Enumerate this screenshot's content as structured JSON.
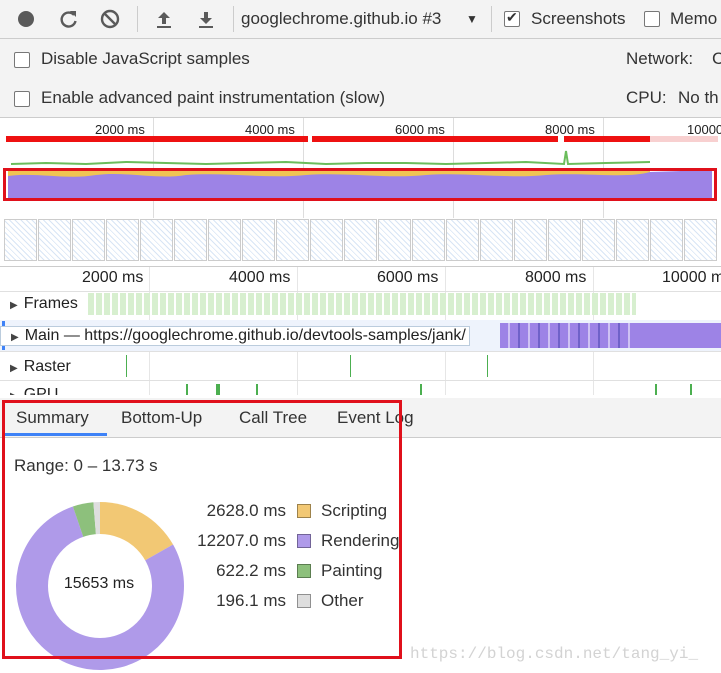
{
  "toolbar": {
    "icons": [
      "record-icon",
      "reload-icon",
      "clear-icon",
      "upload-icon",
      "download-icon"
    ],
    "profile_select": "googlechrome.github.io #3",
    "screenshots_label": "Screenshots",
    "screenshots_checked": true,
    "memory_label": "Memo",
    "memory_checked": false
  },
  "settings": {
    "disable_js_label": "Disable JavaScript samples",
    "paint_label": "Enable advanced paint instrumentation (slow)",
    "network_label": "Network:",
    "network_value": "C",
    "cpu_label": "CPU:",
    "cpu_value": "No th"
  },
  "overview": {
    "ticks": [
      "2000 ms",
      "4000 ms",
      "6000 ms",
      "8000 ms",
      "10000"
    ]
  },
  "timeline": {
    "ticks": [
      "2000 ms",
      "4000 ms",
      "6000 ms",
      "8000 ms",
      "10000 m"
    ],
    "tracks": {
      "frames": "Frames",
      "main": "Main — https://googlechrome.github.io/devtools-samples/jank/",
      "raster": "Raster",
      "gpu": "GPU"
    }
  },
  "tabs": [
    "Summary",
    "Bottom-Up",
    "Call Tree",
    "Event Log"
  ],
  "summary": {
    "range": "Range: 0 – 13.73 s",
    "total": "15653 ms",
    "items": [
      {
        "value": "2628.0 ms",
        "label": "Scripting",
        "color": "#f2c874"
      },
      {
        "value": "12207.0 ms",
        "label": "Rendering",
        "color": "#af9ae9"
      },
      {
        "value": "622.2 ms",
        "label": "Painting",
        "color": "#8dc07c"
      },
      {
        "value": "196.1 ms",
        "label": "Other",
        "color": "#dedede"
      }
    ],
    "donut_ms": [
      2628.0,
      12207.0,
      622.2,
      196.1
    ]
  },
  "watermark": "https://blog.csdn.net/tang_yi_"
}
